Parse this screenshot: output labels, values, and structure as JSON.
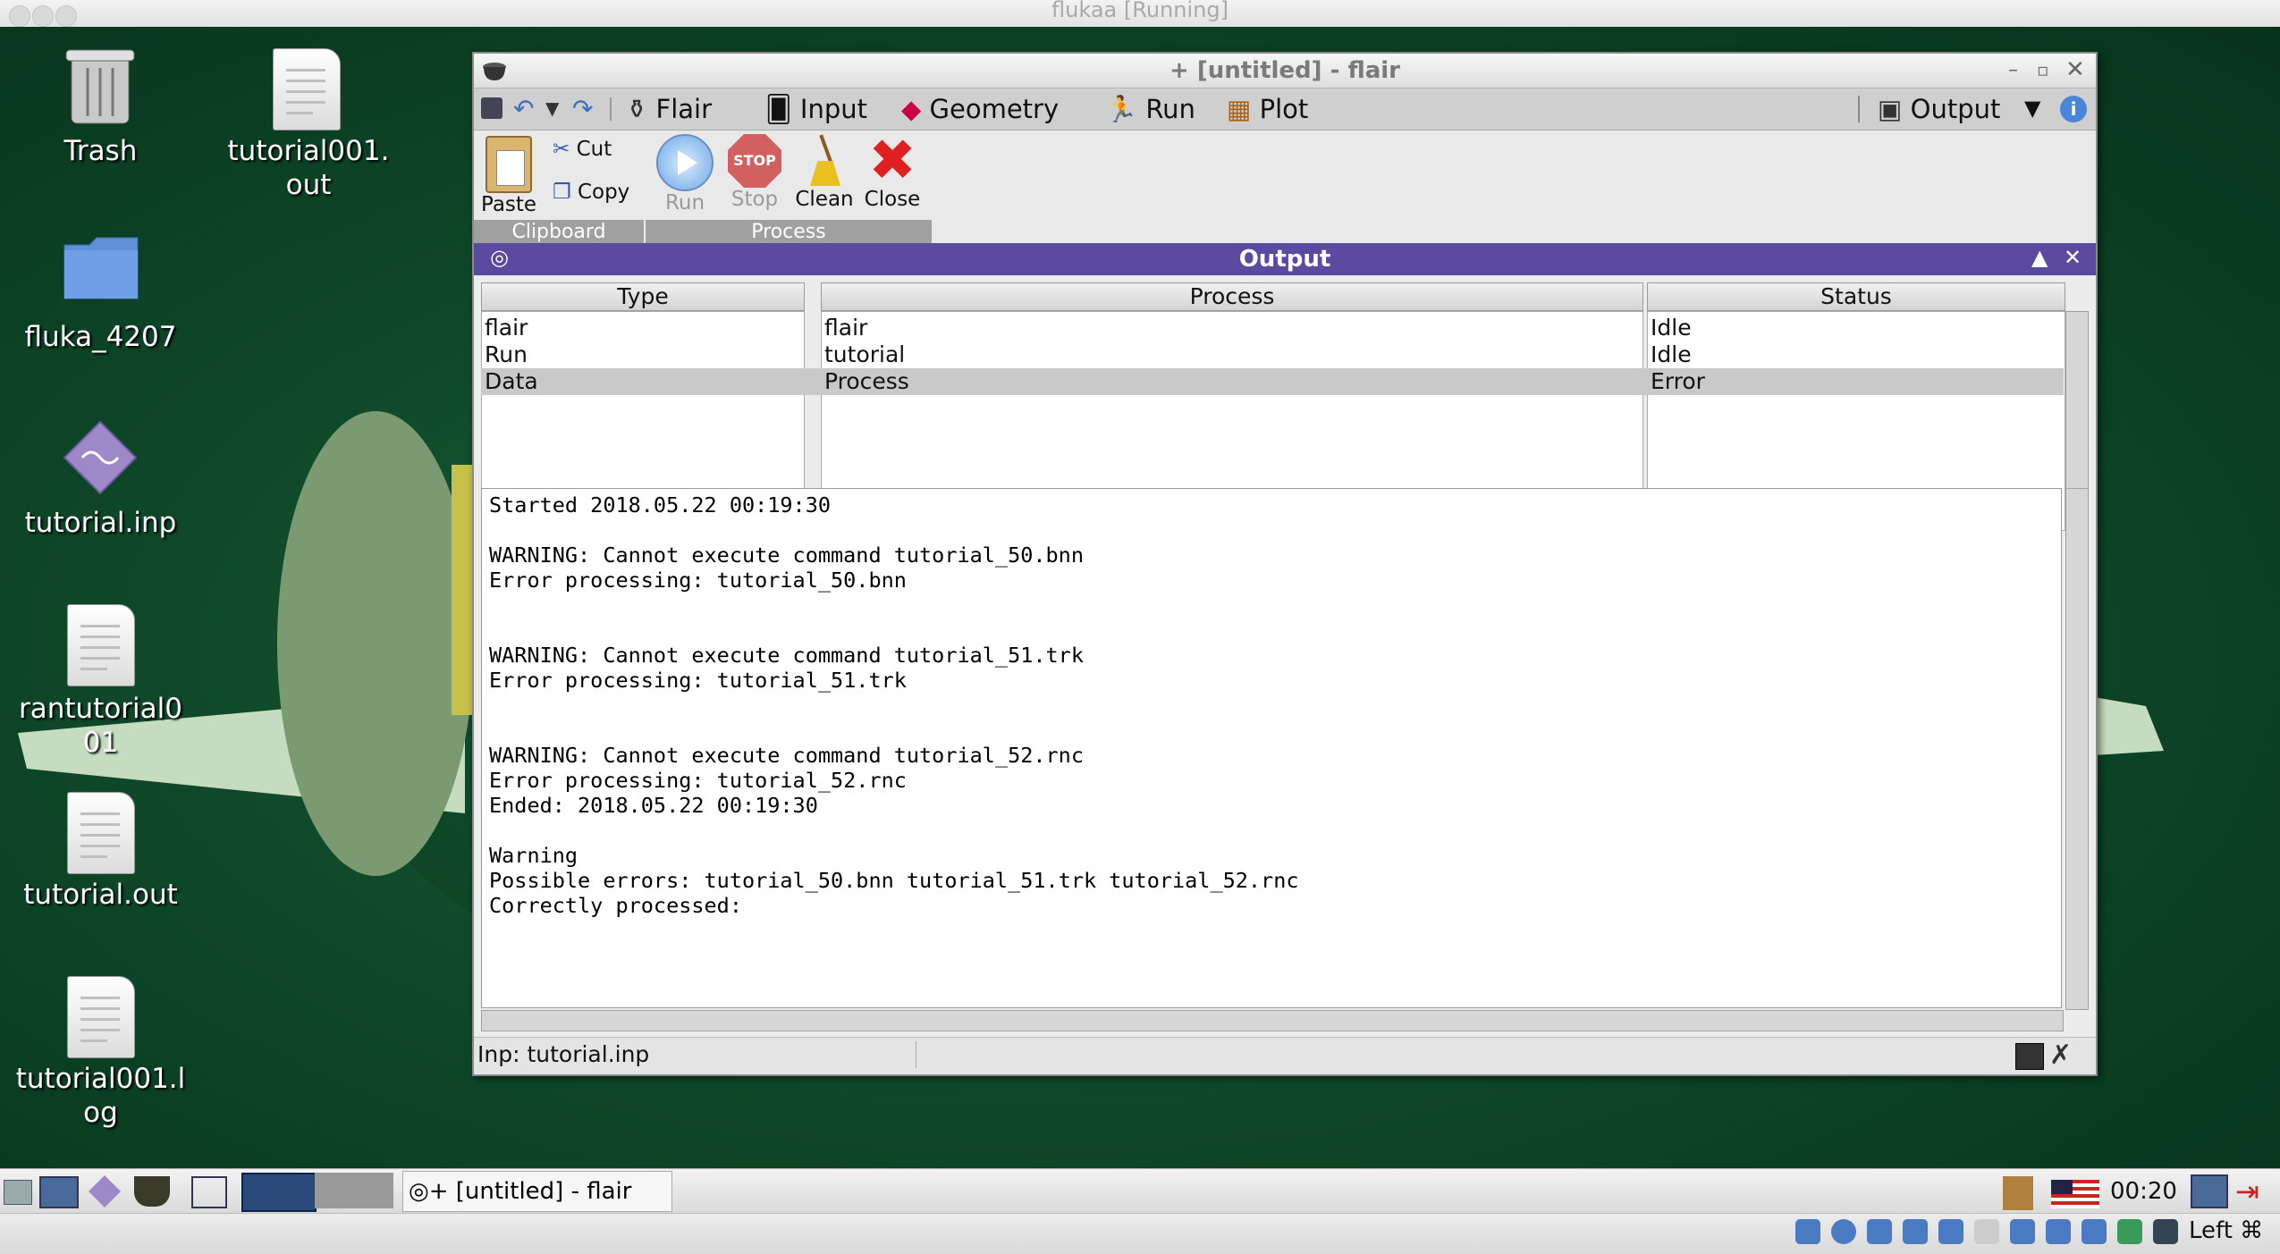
{
  "host": {
    "title": "flukaa [Running]",
    "keyboard_label": "Left ⌘"
  },
  "desktop": {
    "icons": [
      {
        "label": "Trash"
      },
      {
        "label": "tutorial001.\nout"
      },
      {
        "label": "fluka_4207"
      },
      {
        "label": "tutorial.inp"
      },
      {
        "label": "rantutorial0\n01"
      },
      {
        "label": "tutorial.out"
      },
      {
        "label": "tutorial001.l\nog"
      }
    ]
  },
  "window": {
    "title": "+ [untitled] - flair",
    "menu": {
      "flair": "Flair",
      "input": "Input",
      "geometry": "Geometry",
      "run": "Run",
      "plot": "Plot",
      "output": "Output"
    },
    "ribbon": {
      "paste": "Paste",
      "cut": "Cut",
      "copy": "Copy",
      "run": "Run",
      "stop": "Stop",
      "clean": "Clean",
      "close": "Close",
      "clipboard_group": "Clipboard",
      "process_group": "Process",
      "stop_sign": "STOP"
    },
    "output_panel": {
      "title": "Output",
      "columns": [
        "Type",
        "Process",
        "Status"
      ],
      "rows": [
        {
          "type": "flair",
          "process": "flair",
          "status": "Idle"
        },
        {
          "type": "Run",
          "process": "tutorial",
          "status": "Idle"
        },
        {
          "type": "Data",
          "process": "Process",
          "status": "Error"
        }
      ],
      "log": "Started 2018.05.22 00:19:30\n\nWARNING: Cannot execute command tutorial_50.bnn\nError processing: tutorial_50.bnn\n\n\nWARNING: Cannot execute command tutorial_51.trk\nError processing: tutorial_51.trk\n\n\nWARNING: Cannot execute command tutorial_52.rnc\nError processing: tutorial_52.rnc\nEnded: 2018.05.22 00:19:30\n\nWarning\nPossible errors: tutorial_50.bnn tutorial_51.trk tutorial_52.rnc\nCorrectly processed:"
    },
    "statusbar": {
      "input_file": "Inp: tutorial.inp"
    }
  },
  "taskbar": {
    "task_label": "+ [untitled] - flair",
    "clock": "00:20"
  },
  "colors": {
    "output_header": "#5a4aa0",
    "selected_row": "#c9c9c9"
  }
}
